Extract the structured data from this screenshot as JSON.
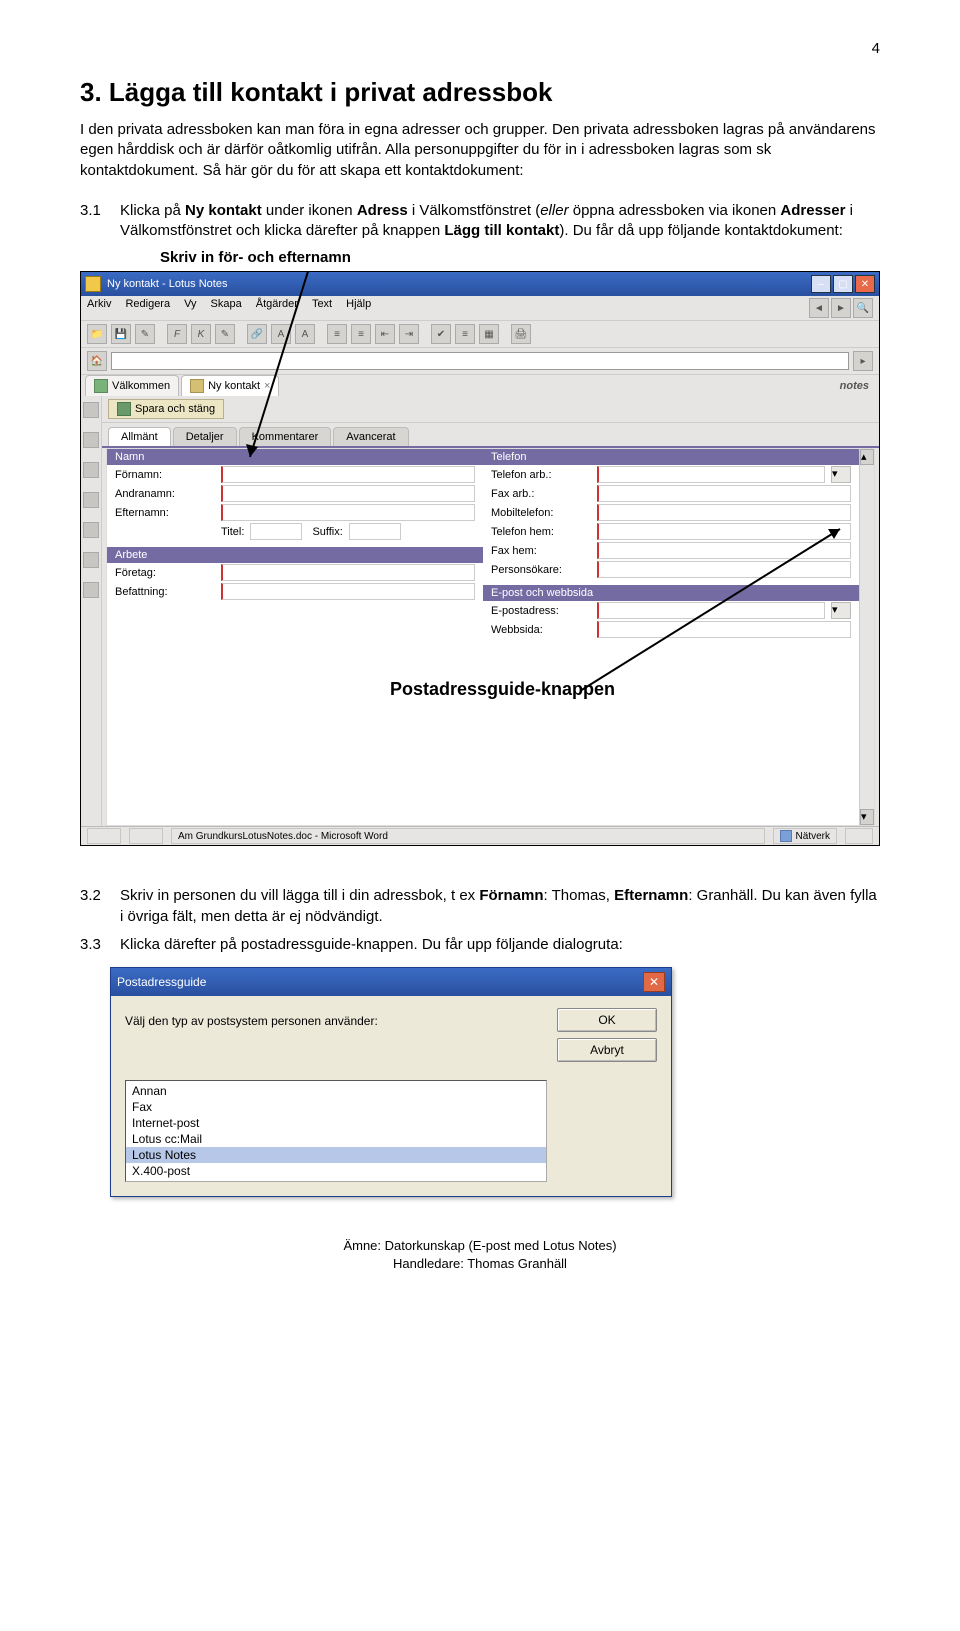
{
  "page_number": "4",
  "heading": "3. Lägga till kontakt i privat adressbok",
  "intro": "I den privata adressboken kan man föra in egna adresser och grupper. Den privata adressboken lagras på användarens egen hårddisk och är därför oåtkomlig utifrån. Alla personuppgifter du för in i adressboken lagras som sk kontaktdokument. Så här gör du för att skapa ett kontaktdokument:",
  "step31_num": "3.1",
  "step31_a": "Klicka på ",
  "step31_b": "Ny kontakt",
  "step31_c": " under ikonen ",
  "step31_d": "Adress",
  "step31_e": " i Välkomstfönstret (",
  "step31_f": "eller",
  "step31_g": " öppna adressboken via ikonen ",
  "step31_h": "Adresser",
  "step31_i": " i Välkomstfönstret och klicka därefter på knappen ",
  "step31_j": "Lägg till kontakt",
  "step31_k": "). Du får då upp följande kontaktdokument:",
  "callout_top": "Skriv in för- och efternamn",
  "win": {
    "title": "Ny kontakt - Lotus Notes",
    "menu": [
      "Arkiv",
      "Redigera",
      "Vy",
      "Skapa",
      "Åtgärder",
      "Text",
      "Hjälp"
    ],
    "tabs": [
      "Välkommen",
      "Ny kontakt"
    ],
    "notes_brand": "notes",
    "save_btn": "Spara och stäng",
    "subtabs": [
      "Allmänt",
      "Detaljer",
      "Kommentarer",
      "Avancerat"
    ],
    "sections_left": {
      "namn": "Namn",
      "fornamn": "Förnamn:",
      "andranamn": "Andranamn:",
      "efternamn": "Efternamn:",
      "titel": "Titel:",
      "suffix": "Suffix:",
      "arbete": "Arbete",
      "foretag": "Företag:",
      "befattning": "Befattning:"
    },
    "sections_right": {
      "telefon": "Telefon",
      "tel_arb": "Telefon arb.:",
      "fax_arb": "Fax arb.:",
      "mobil": "Mobiltelefon:",
      "tel_hem": "Telefon hem:",
      "fax_hem": "Fax hem:",
      "personsokare": "Personsökare:",
      "epostweb": "E-post och webbsida",
      "epostadress": "E-postadress:",
      "webbsida": "Webbsida:"
    },
    "status_center": "Am GrundkursLotusNotes.doc - Microsoft Word",
    "status_right": "Nätverk"
  },
  "callout_post": "Postadressguide-knappen",
  "step32_num": "3.2",
  "step32_a": "Skriv in personen du vill lägga till i din adressbok, t ex ",
  "step32_b": "Förnamn",
  "step32_c": ": Thomas, ",
  "step32_d": "Efternamn",
  "step32_e": ": Granhäll. Du kan även fylla i övriga fält, men detta är ej nödvändigt.",
  "step33_num": "3.3",
  "step33": "Klicka därefter på postadressguide-knappen. Du får upp följande dialogruta:",
  "dialog": {
    "title": "Postadressguide",
    "prompt": "Välj den typ av postsystem personen använder:",
    "ok": "OK",
    "cancel": "Avbryt",
    "items": [
      "Annan",
      "Fax",
      "Internet-post",
      "Lotus cc:Mail",
      "Lotus Notes",
      "X.400-post"
    ],
    "selected_index": 4
  },
  "footer_line1": "Ämne: Datorkunskap (E-post med Lotus Notes)",
  "footer_line2": "Handledare: Thomas Granhäll"
}
